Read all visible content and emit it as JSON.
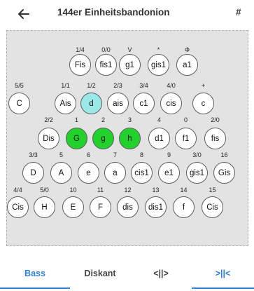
{
  "appbar": {
    "title": "144er Einheitsbandonion",
    "menu_glyph": "#"
  },
  "board": {
    "rows": [
      [
        {
          "label": "1/4",
          "note": "Fis",
          "state": "none"
        },
        {
          "label": "0/0",
          "note": "fis1",
          "state": "none"
        },
        {
          "label": "V",
          "note": "g1",
          "state": "none"
        },
        {
          "label": "*",
          "note": "gis1",
          "state": "none"
        },
        {
          "label": "Φ",
          "note": "a1",
          "state": "none"
        }
      ],
      [
        {
          "label": "5/5",
          "note": "C",
          "state": "none"
        },
        {
          "label": "1/1",
          "note": "Ais",
          "state": "none"
        },
        {
          "label": "1/2",
          "note": "d",
          "state": "cyan"
        },
        {
          "label": "2/3",
          "note": "ais",
          "state": "none"
        },
        {
          "label": "3/4",
          "note": "c1",
          "state": "none"
        },
        {
          "label": "4/0",
          "note": "cis",
          "state": "none"
        },
        {
          "label": "+",
          "note": "c",
          "state": "none"
        }
      ],
      [
        {
          "label": "2/2",
          "note": "Dis",
          "state": "none"
        },
        {
          "label": "1",
          "note": "G",
          "state": "green"
        },
        {
          "label": "2",
          "note": "g",
          "state": "green"
        },
        {
          "label": "3",
          "note": "h",
          "state": "green"
        },
        {
          "label": "4",
          "note": "d1",
          "state": "none"
        },
        {
          "label": "0",
          "note": "f1",
          "state": "none"
        },
        {
          "label": "2/0",
          "note": "fis",
          "state": "none"
        }
      ],
      [
        {
          "label": "3/3",
          "note": "D",
          "state": "none"
        },
        {
          "label": "5",
          "note": "A",
          "state": "none"
        },
        {
          "label": "6",
          "note": "e",
          "state": "none"
        },
        {
          "label": "7",
          "note": "a",
          "state": "none"
        },
        {
          "label": "8",
          "note": "cis1",
          "state": "none"
        },
        {
          "label": "9",
          "note": "e1",
          "state": "none"
        },
        {
          "label": "3/0",
          "note": "gis1",
          "state": "none"
        },
        {
          "label": "16",
          "note": "Gis",
          "state": "none"
        }
      ],
      [
        {
          "label": "4/4",
          "note": "Cis",
          "state": "none"
        },
        {
          "label": "5/0",
          "note": "H",
          "state": "none"
        },
        {
          "label": "10",
          "note": "E",
          "state": "none"
        },
        {
          "label": "11",
          "note": "F",
          "state": "none"
        },
        {
          "label": "12",
          "note": "dis",
          "state": "none"
        },
        {
          "label": "13",
          "note": "dis1",
          "state": "none"
        },
        {
          "label": "14",
          "note": "f",
          "state": "none"
        },
        {
          "label": "15",
          "note": "Cis",
          "state": "none"
        }
      ]
    ]
  },
  "tabs": [
    {
      "label": "Bass",
      "active": true
    },
    {
      "label": "Diskant",
      "active": false
    },
    {
      "label": "<||>",
      "active": false
    },
    {
      "label": ">||<",
      "active": false
    }
  ],
  "colors": {
    "accent": "#2d7fe0",
    "cyan_button": "#9ae8e8",
    "green_button": "#22d12b",
    "board_bg": "#e3e3e3"
  },
  "icons": {
    "back": "arrow-left-icon"
  }
}
